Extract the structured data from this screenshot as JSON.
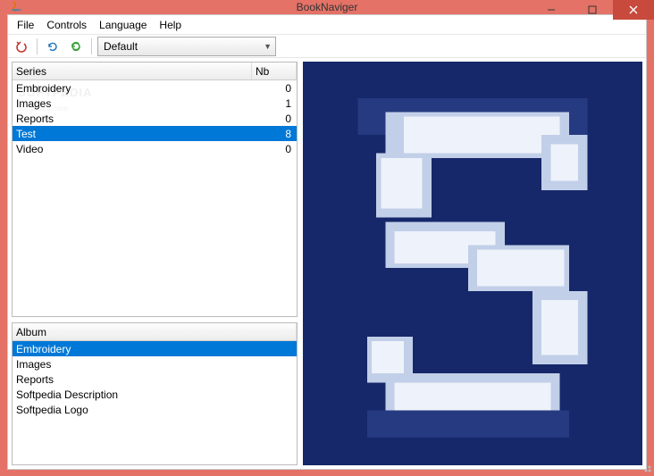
{
  "window": {
    "title": "BookNaviger"
  },
  "menu": {
    "file": "File",
    "controls": "Controls",
    "language": "Language",
    "help": "Help"
  },
  "toolbar": {
    "library_selected": "Default"
  },
  "series_table": {
    "header_series": "Series",
    "header_nb": "Nb",
    "rows": [
      {
        "name": "Embroidery",
        "nb": "0",
        "selected": false
      },
      {
        "name": "Images",
        "nb": "1",
        "selected": false
      },
      {
        "name": "Reports",
        "nb": "0",
        "selected": false
      },
      {
        "name": "Test",
        "nb": "8",
        "selected": true
      },
      {
        "name": "Video",
        "nb": "0",
        "selected": false
      }
    ]
  },
  "album_table": {
    "header_album": "Album",
    "rows": [
      {
        "name": "Embroidery",
        "selected": true
      },
      {
        "name": "Images",
        "selected": false
      },
      {
        "name": "Reports",
        "selected": false
      },
      {
        "name": "Softpedia Description",
        "selected": false
      },
      {
        "name": "Softpedia Logo",
        "selected": false
      }
    ]
  }
}
